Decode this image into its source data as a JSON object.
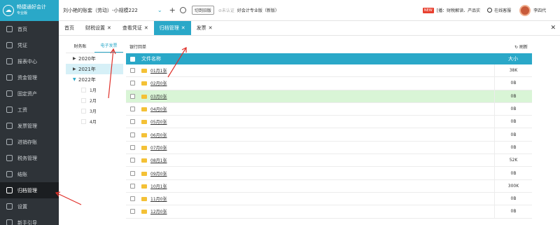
{
  "app": {
    "logo_title": "畅捷通好会计",
    "logo_sub": "专业版"
  },
  "topbar": {
    "company": "刘小艳的账套（劳动）-小规模222",
    "switch_old": "切到旧版",
    "unverified": "未认证",
    "edition": "好会计专业版（新版）",
    "news_tag": "NEW",
    "news_text": "[播：财税解读、产品实",
    "support": "在线客服",
    "username": "李四代"
  },
  "sidebar": {
    "items": [
      {
        "label": "首页",
        "icon": "home-icon"
      },
      {
        "label": "凭证",
        "icon": "voucher-icon"
      },
      {
        "label": "报表中心",
        "icon": "chart-icon"
      },
      {
        "label": "资金管理",
        "icon": "money-icon"
      },
      {
        "label": "固定资产",
        "icon": "asset-icon"
      },
      {
        "label": "工资",
        "icon": "salary-icon"
      },
      {
        "label": "发票管理",
        "icon": "invoice-icon"
      },
      {
        "label": "进销存账",
        "icon": "inventory-icon"
      },
      {
        "label": "税务管理",
        "icon": "tax-icon"
      },
      {
        "label": "结账",
        "icon": "close-book-icon"
      },
      {
        "label": "归档管理",
        "icon": "archive-icon",
        "active": true
      },
      {
        "label": "设置",
        "icon": "gear-icon"
      },
      {
        "label": "新手引导",
        "icon": "guide-icon"
      }
    ]
  },
  "tabs": [
    {
      "label": "首页",
      "closable": false
    },
    {
      "label": "财税设置",
      "closable": true
    },
    {
      "label": "查看凭证",
      "closable": true
    },
    {
      "label": "归档管理",
      "closable": true,
      "active": true
    },
    {
      "label": "发票",
      "closable": true
    }
  ],
  "tree": {
    "subtabs": [
      "财务账",
      "电子发票"
    ],
    "active_subtab": 1,
    "years": [
      {
        "label": "2020年",
        "state": "collapsed"
      },
      {
        "label": "2021年",
        "state": "collapsed",
        "selected": true
      },
      {
        "label": "2022年",
        "state": "expanded",
        "months": [
          "1月",
          "2月",
          "3月",
          "4月"
        ]
      }
    ]
  },
  "table": {
    "bank_receipt": "银行回单",
    "refresh": "刷新",
    "col_name": "文件名称",
    "col_size": "大小",
    "rows": [
      {
        "name": "01月1张",
        "size": "38K"
      },
      {
        "name": "02月0张",
        "size": "0B"
      },
      {
        "name": "03月0张",
        "size": "0B",
        "highlight": true
      },
      {
        "name": "04月0张",
        "size": "0B"
      },
      {
        "name": "05月0张",
        "size": "0B"
      },
      {
        "name": "06月0张",
        "size": "0B"
      },
      {
        "name": "07月0张",
        "size": "0B"
      },
      {
        "name": "08月1张",
        "size": "52K"
      },
      {
        "name": "09月0张",
        "size": "0B"
      },
      {
        "name": "10月1张",
        "size": "300K"
      },
      {
        "name": "11月0张",
        "size": "0B"
      },
      {
        "name": "12月0张",
        "size": "0B"
      }
    ]
  },
  "colors": {
    "accent": "#2aa8c8",
    "sidebar": "#2e3338",
    "highlight_row": "#d9f5d6",
    "annotation": "#e0302a"
  }
}
